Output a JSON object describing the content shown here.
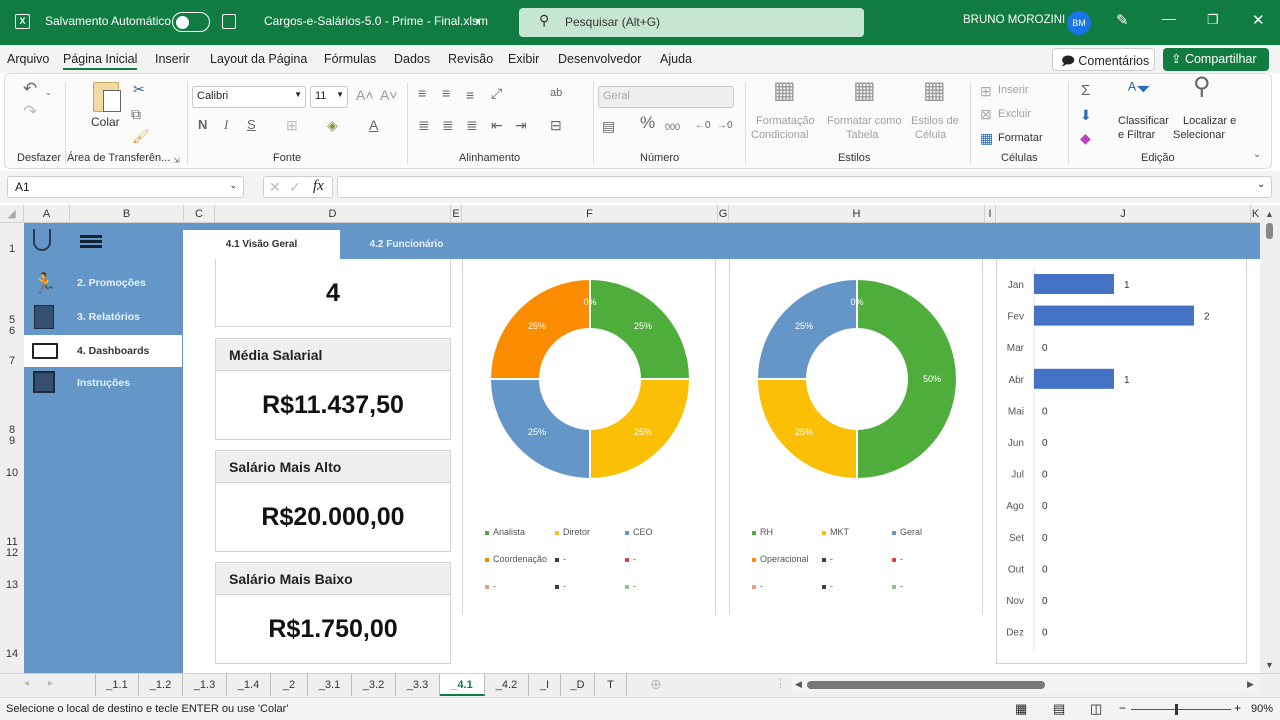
{
  "titlebar": {
    "autosave_label": "Salvamento Automático",
    "autosave_on": false,
    "file_name": "Cargos-e-Salários-5.0 - Prime - Final.xlsm",
    "search_placeholder": "Pesquisar (Alt+G)",
    "user_name": "BRUNO MOROZINI",
    "user_initials": "BM"
  },
  "menu": {
    "items": [
      "Arquivo",
      "Página Inicial",
      "Inserir",
      "Layout da Página",
      "Fórmulas",
      "Dados",
      "Revisão",
      "Exibir",
      "Desenvolvedor",
      "Ajuda"
    ],
    "active": "Página Inicial",
    "comments_label": "Comentários",
    "share_label": "Compartilhar"
  },
  "ribbon": {
    "groups": {
      "undo": "Desfazer",
      "clipboard": "Área de Transferên...",
      "font": "Fonte",
      "alignment": "Alinhamento",
      "number": "Número",
      "styles": "Estilos",
      "cells": "Células",
      "editing": "Edição"
    },
    "paste_label": "Colar",
    "font_name": "Calibri",
    "font_size": "11",
    "bold": "N",
    "italic": "I",
    "underline": "S",
    "number_format": "Geral",
    "conditional_format": [
      "Formatação",
      "Condicional"
    ],
    "format_table": [
      "Formatar como",
      "Tabela"
    ],
    "cell_styles": [
      "Estilos de",
      "Célula"
    ],
    "insert": "Inserir",
    "delete": "Excluir",
    "format": "Formatar",
    "sort_filter": [
      "Classificar",
      "e Filtrar"
    ],
    "find_select": [
      "Localizar e",
      "Selecionar"
    ]
  },
  "formula_bar": {
    "name_box": "A1",
    "formula": ""
  },
  "columns": [
    "A",
    "B",
    "C",
    "D",
    "E",
    "F",
    "G",
    "H",
    "I",
    "J",
    "K"
  ],
  "rows": [
    "1",
    "5",
    "6",
    "7",
    "8",
    "9",
    "10",
    "11",
    "12",
    "13",
    "14"
  ],
  "dashboard": {
    "tabs": [
      "4.1 Visão Geral",
      "4.2 Funcionário"
    ],
    "active_tab": "4.1 Visão Geral",
    "nav": [
      {
        "label": "2. Promoções",
        "icon": "runner-icon"
      },
      {
        "label": "3. Relatórios",
        "icon": "report-icon"
      },
      {
        "label": "4. Dashboards",
        "icon": "dashboard-icon",
        "active": true
      },
      {
        "label": "Instruções",
        "icon": "instructions-icon"
      }
    ],
    "cards": [
      {
        "title": "",
        "value": "4"
      },
      {
        "title": "Média Salarial",
        "value": "R$11.437,50"
      },
      {
        "title": "Salário Mais Alto",
        "value": "R$20.000,00"
      },
      {
        "title": "Salário Mais Baixo",
        "value": "R$1.750,00"
      }
    ]
  },
  "chart_data": [
    {
      "type": "pie",
      "subtype": "doughnut",
      "title": "",
      "categories": [
        "Analista",
        "Diretor",
        "CEO",
        "Coordenação",
        "-",
        "-"
      ],
      "values": [
        25,
        25,
        25,
        25,
        0,
        0
      ],
      "labels": [
        "25%",
        "25%",
        "25%",
        "25%",
        "0%"
      ],
      "colors": [
        "#4fad3b",
        "#fbbf05",
        "#6497c8",
        "#fb8c00",
        "#404040",
        "#e04040"
      ],
      "legend": [
        "Analista",
        "Diretor",
        "CEO",
        "Coordenação",
        "-",
        "-",
        "-",
        "-",
        "-"
      ],
      "legend_colors": [
        "#4fad3b",
        "#fbbf05",
        "#6497c8",
        "#fb8c00",
        "#404040",
        "#e04040",
        "#e0a080",
        "#404040",
        "#8fc08f"
      ],
      "legend_position": "bottom"
    },
    {
      "type": "pie",
      "subtype": "doughnut",
      "title": "",
      "categories": [
        "RH",
        "MKT",
        "Geral",
        "Operacional"
      ],
      "values": [
        50,
        25,
        25,
        0
      ],
      "labels": [
        "50%",
        "25%",
        "25%",
        "0%"
      ],
      "colors": [
        "#4fad3b",
        "#fbbf05",
        "#6497c8",
        "#fb8c00"
      ],
      "legend": [
        "RH",
        "MKT",
        "Geral",
        "Operacional",
        "-",
        "-",
        "-",
        "-",
        "-"
      ],
      "legend_colors": [
        "#4fad3b",
        "#fbbf05",
        "#6497c8",
        "#fb8c00",
        "#404040",
        "#e04040",
        "#e0a080",
        "#404040",
        "#8fc08f"
      ],
      "legend_position": "bottom"
    },
    {
      "type": "bar",
      "orientation": "horizontal",
      "title": "",
      "categories": [
        "Jan",
        "Fev",
        "Mar",
        "Abr",
        "Mai",
        "Jun",
        "Jul",
        "Ago",
        "Set",
        "Out",
        "Nov",
        "Dez"
      ],
      "values": [
        1,
        2,
        0,
        1,
        0,
        0,
        0,
        0,
        0,
        0,
        0,
        0
      ],
      "color": "#4472c4",
      "xlim": [
        0,
        2.5
      ],
      "data_labels": true,
      "grid": false
    }
  ],
  "sheet_tabs": [
    "_1.1",
    "_1.2",
    "_1.3",
    "_1.4",
    "_2",
    "_3.1",
    "_3.2",
    "_3.3",
    "_4.1",
    "_4.2",
    "_I",
    "_D",
    "T"
  ],
  "active_sheet": "_4.1",
  "status": {
    "message": "Selecione o local de destino e tecle ENTER ou use 'Colar'",
    "zoom": "90%"
  }
}
